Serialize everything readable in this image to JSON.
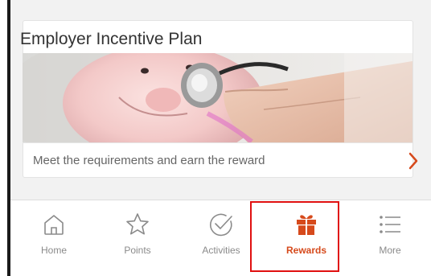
{
  "card": {
    "title": "Employer Incentive Plan",
    "subtitle": "Meet the requirements and earn the reward",
    "chevron_icon": "chevron-right-icon",
    "image": "piggy-bank-stethoscope-photo"
  },
  "nav": {
    "items": [
      {
        "label": "Home",
        "icon": "home-icon"
      },
      {
        "label": "Points",
        "icon": "star-icon"
      },
      {
        "label": "Activities",
        "icon": "check-circle-icon"
      },
      {
        "label": "Rewards",
        "icon": "gift-icon"
      },
      {
        "label": "More",
        "icon": "list-icon"
      }
    ],
    "active": "Rewards"
  },
  "colors": {
    "accent": "#d64a1c",
    "inactive": "#8a8a8a",
    "highlight": "#e01010",
    "background": "#f2f2f2"
  }
}
